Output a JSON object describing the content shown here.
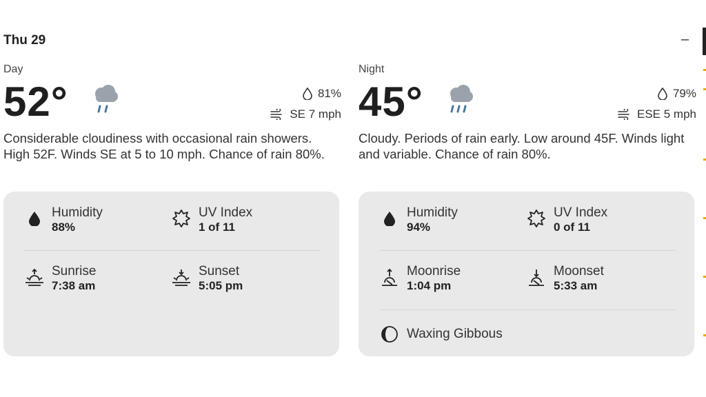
{
  "date": "Thu 29",
  "collapse_icon": "minus-icon",
  "day": {
    "period": "Day",
    "temp": "52°",
    "condition_icon": "rain-cloud-icon",
    "humidity": "81%",
    "wind": "SE 7 mph",
    "description": "Considerable cloudiness with occasional rain showers. High 52F. Winds SE at 5 to 10 mph. Chance of rain 80%.",
    "details": {
      "humidity_label": "Humidity",
      "humidity_value": "88%",
      "uv_label": "UV Index",
      "uv_value": "1 of 11",
      "rise_label": "Sunrise",
      "rise_value": "7:38 am",
      "set_label": "Sunset",
      "set_value": "5:05 pm"
    }
  },
  "night": {
    "period": "Night",
    "temp": "45°",
    "condition_icon": "rain-cloud-icon",
    "humidity": "79%",
    "wind": "ESE 5 mph",
    "description": "Cloudy. Periods of rain early. Low around 45F. Winds light and variable. Chance of rain 80%.",
    "details": {
      "humidity_label": "Humidity",
      "humidity_value": "94%",
      "uv_label": "UV Index",
      "uv_value": "0 of 11",
      "rise_label": "Moonrise",
      "rise_value": "1:04 pm",
      "set_label": "Moonset",
      "set_value": "5:33 am",
      "moon_phase": "Waxing Gibbous"
    }
  },
  "colors": {
    "card_bg": "#e9e9e9",
    "rain_cloud": "#9aa3ab",
    "rain_drops": "#4a7a9a"
  }
}
